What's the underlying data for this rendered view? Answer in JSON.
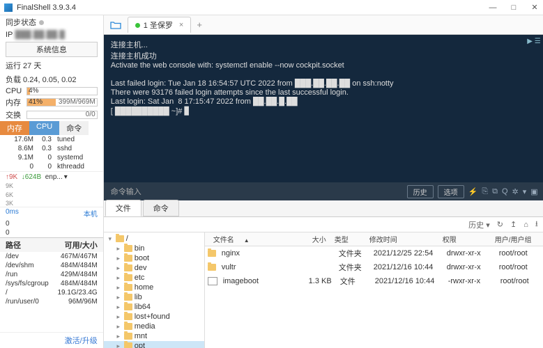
{
  "title": "FinalShell 3.9.3.4",
  "winbtns": {
    "min": "—",
    "max": "□",
    "close": "✕"
  },
  "sidebar": {
    "sync_status": "同步状态",
    "ip_label": "IP",
    "ip_value": "███.██.██.█",
    "sysinfo": "系统信息",
    "uptime": "运行 27 天",
    "load": "负载 0.24, 0.05, 0.02",
    "cpu": {
      "label": "CPU",
      "pct": "4%",
      "fill": 4
    },
    "mem": {
      "label": "内存",
      "pct": "41%",
      "right": "399M/969M",
      "fill": 41
    },
    "swap": {
      "label": "交换",
      "pct": "",
      "right": "0/0",
      "fill": 0
    },
    "tabs": {
      "mem": "内存",
      "cpu": "CPU",
      "cmd": "命令"
    },
    "procs": [
      {
        "m": "17.6M",
        "c": "0.3",
        "n": "tuned"
      },
      {
        "m": "8.6M",
        "c": "0.3",
        "n": "sshd"
      },
      {
        "m": "9.1M",
        "c": "0",
        "n": "systemd"
      },
      {
        "m": "0",
        "c": "0",
        "n": "kthreadd"
      }
    ],
    "net": {
      "up": "↑9K",
      "dn": "↓624B",
      "iface": "enp...",
      "dd": "▾"
    },
    "chart_y": [
      "9K",
      "6K",
      "3K"
    ],
    "ms": {
      "v": "0ms",
      "host": "本机",
      "l0": "0",
      "l1": "0"
    },
    "path_hdr": {
      "a": "路径",
      "b": "可用/大小"
    },
    "paths": [
      {
        "p": "/dev",
        "s": "467M/467M"
      },
      {
        "p": "/dev/shm",
        "s": "484M/484M"
      },
      {
        "p": "/run",
        "s": "429M/484M"
      },
      {
        "p": "/sys/fs/cgroup",
        "s": "484M/484M"
      },
      {
        "p": "/",
        "s": "19.1G/23.4G"
      },
      {
        "p": "/run/user/0",
        "s": "96M/96M"
      }
    ],
    "activate": "激活/升级"
  },
  "tab": {
    "name": "1 圣保罗",
    "close": "×",
    "plus": "+"
  },
  "term": {
    "play": "▶ ☰",
    "lines": "连接主机...\n连接主机成功\nActivate the web console with: systemctl enable --now cockpit.socket\n\nLast failed login: Tue Jan 18 16:54:57 UTC 2022 from ███.██.██.██ on ssh:notty\nThere were 93176 failed login attempts since the last successful login.\nLast login: Sat Jan  8 17:15:47 2022 from ██.██.█.██\n[ ██████████ ~]# ▊"
  },
  "cmd": {
    "placeholder": "命令输入",
    "history": "历史",
    "options": "选项"
  },
  "filetabs": {
    "files": "文件",
    "cmd": "命令"
  },
  "toolbar": {
    "history": "历史"
  },
  "tree": {
    "root": "/",
    "items": [
      "bin",
      "boot",
      "dev",
      "etc",
      "home",
      "lib",
      "lib64",
      "lost+found",
      "media",
      "mnt",
      "opt"
    ]
  },
  "filelist": {
    "hdr": {
      "name": "文件名",
      "size": "大小",
      "type": "类型",
      "date": "修改时间",
      "perm": "权限",
      "own": "用户/用户组"
    },
    "path": "/opt",
    "rows": [
      {
        "ico": "f",
        "name": "nginx",
        "size": "",
        "type": "文件夹",
        "date": "2021/12/25 22:54",
        "perm": "drwxr-xr-x",
        "own": "root/root"
      },
      {
        "ico": "f",
        "name": "vultr",
        "size": "",
        "type": "文件夹",
        "date": "2021/12/16 10:44",
        "perm": "drwxr-xr-x",
        "own": "root/root"
      },
      {
        "ico": "d",
        "name": "imageboot",
        "size": "1.3 KB",
        "type": "文件",
        "date": "2021/12/16 10:44",
        "perm": "-rwxr-xr-x",
        "own": "root/root"
      }
    ]
  }
}
